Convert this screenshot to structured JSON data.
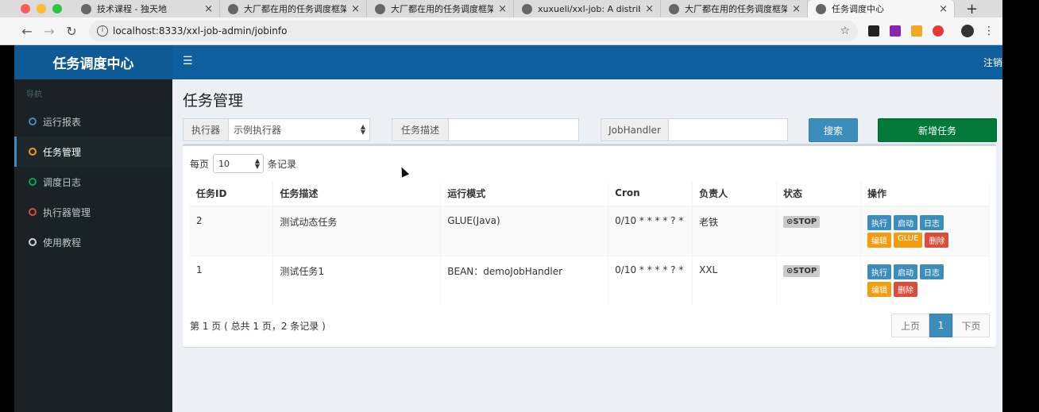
{
  "browser": {
    "tabs": [
      {
        "title": "技术课程 - 独天地",
        "active": false
      },
      {
        "title": "大厂都在用的任务调度框架",
        "active": false
      },
      {
        "title": "大厂都在用的任务调度框架",
        "active": false
      },
      {
        "title": "xuxueli/xxl-job: A distributed",
        "active": false
      },
      {
        "title": "大厂都在用的任务调度框架",
        "active": false
      },
      {
        "title": "任务调度中心",
        "active": true
      }
    ],
    "new_tab": "+",
    "url": "localhost:8333/xxl-job-admin/jobinfo",
    "colors": {
      "close": "#ff5f57",
      "minimize": "#febc2e",
      "maximize": "#28c840"
    }
  },
  "app": {
    "logo": "任务调度中心",
    "menu_icon": "☰",
    "logout": "注销",
    "nav_header": "导航",
    "nav": [
      {
        "label": "运行报表",
        "color": "#3c8dbc",
        "active": false
      },
      {
        "label": "任务管理",
        "color": "#f39c12",
        "active": true
      },
      {
        "label": "调度日志",
        "color": "#00a65a",
        "active": false
      },
      {
        "label": "执行器管理",
        "color": "#dd4b39",
        "active": false
      },
      {
        "label": "使用教程",
        "color": "#d2d6de",
        "active": false
      }
    ]
  },
  "page": {
    "title": "任务管理",
    "filters": {
      "executor_label": "执行器",
      "executor_value": "示例执行器",
      "desc_label": "任务描述",
      "desc_value": "",
      "handler_label": "JobHandler",
      "handler_value": "",
      "search_button": "搜索",
      "add_button": "新增任务"
    },
    "length": {
      "prefix": "每页",
      "value": "10",
      "suffix": "条记录"
    },
    "table": {
      "headers": [
        "任务ID",
        "任务描述",
        "运行模式",
        "Cron",
        "负责人",
        "状态",
        "操作"
      ],
      "rows": [
        {
          "id": "2",
          "desc": "测试动态任务",
          "mode": "GLUE(Java)",
          "cron": "0/10 * * * * ? *",
          "owner": "老铁",
          "status": "⊙STOP",
          "ops": [
            {
              "label": "执行",
              "kind": "blue"
            },
            {
              "label": "启动",
              "kind": "blue"
            },
            {
              "label": "日志",
              "kind": "blue"
            },
            {
              "label": "编辑",
              "kind": "orange"
            },
            {
              "label": "GLUE",
              "kind": "orange"
            },
            {
              "label": "删除",
              "kind": "red"
            }
          ]
        },
        {
          "id": "1",
          "desc": "测试任务1",
          "mode": "BEAN：demoJobHandler",
          "cron": "0/10 * * * * ? *",
          "owner": "XXL",
          "status": "⊙STOP",
          "ops": [
            {
              "label": "执行",
              "kind": "blue"
            },
            {
              "label": "启动",
              "kind": "blue"
            },
            {
              "label": "日志",
              "kind": "blue"
            },
            {
              "label": "编辑",
              "kind": "orange"
            },
            {
              "label": "删除",
              "kind": "red"
            }
          ]
        }
      ]
    },
    "info": "第 1 页 ( 总共 1 页，2 条记录 )",
    "pager": {
      "prev": "上页",
      "current": "1",
      "next": "下页"
    }
  }
}
